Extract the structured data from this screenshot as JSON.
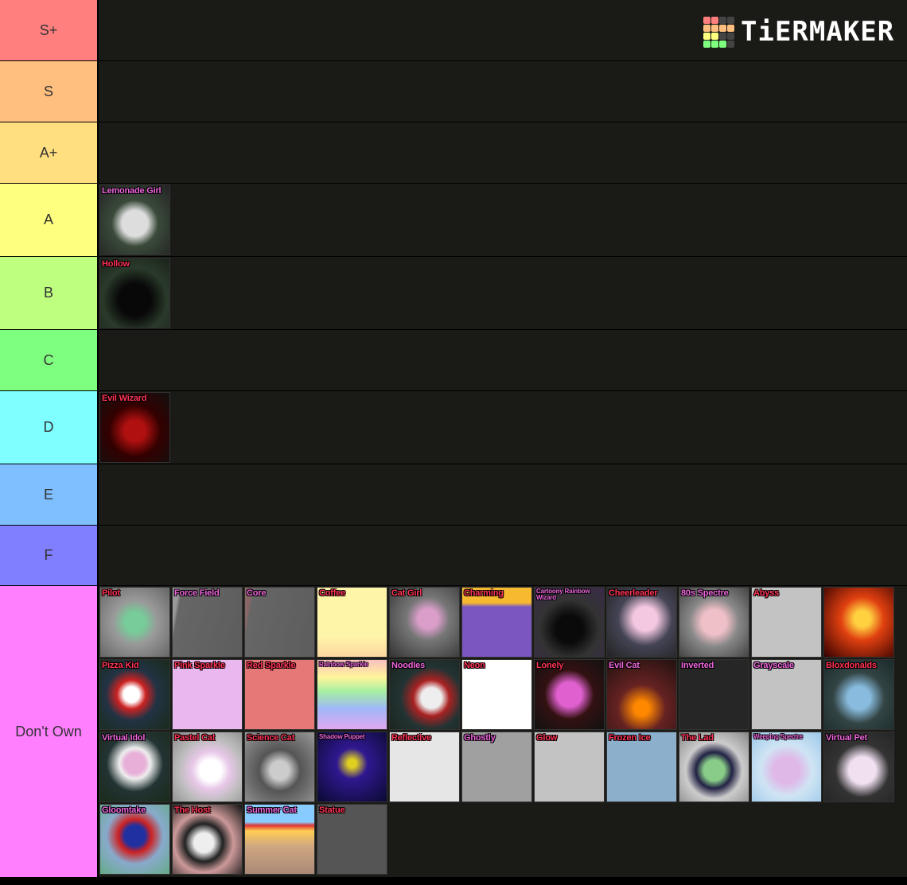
{
  "brand": {
    "logo_text": "TiERMAKER",
    "grid_colors": [
      "#ff7f7f",
      "#ff7f7f",
      "#444",
      "#444",
      "#ffbf7f",
      "#ffbf7f",
      "#ffbf7f",
      "#ffbf7f",
      "#ffff7f",
      "#ffff7f",
      "#444",
      "#444",
      "#7fff7f",
      "#7fff7f",
      "#7fff7f",
      "#444"
    ]
  },
  "tiers": [
    {
      "label": "S+",
      "color": "#ff7f7f",
      "items": []
    },
    {
      "label": "S",
      "color": "#ffbf7f",
      "items": []
    },
    {
      "label": "A+",
      "color": "#ffdf7f",
      "items": []
    },
    {
      "label": "A",
      "color": "#ffff7f",
      "items": [
        {
          "name": "Lemonade Girl",
          "c": "pink",
          "bg": "radial-gradient(circle at 50% 55%,#ddd 0 25%,#3a4a3a 45%,#222)"
        }
      ]
    },
    {
      "label": "B",
      "color": "#bfff7f",
      "items": [
        {
          "name": "Hollow",
          "c": "red",
          "bg": "radial-gradient(circle at 50% 60%,#080808 0 30%,#2a3a2a 60%,#1a221a)"
        }
      ]
    },
    {
      "label": "C",
      "color": "#7fff7f",
      "items": []
    },
    {
      "label": "D",
      "color": "#7fffff",
      "items": [
        {
          "name": "Evil Wizard",
          "c": "red",
          "bg": "radial-gradient(circle at 50% 55%,#b01010 0 20%,#300 50%,#111)"
        }
      ]
    },
    {
      "label": "E",
      "color": "#7fbfff",
      "items": []
    },
    {
      "label": "F",
      "color": "#7f7fff",
      "items": []
    },
    {
      "label": "Don't Own",
      "color": "#ff7fff",
      "items": [
        {
          "name": "Pilot",
          "c": "red",
          "bg": "radial-gradient(circle at 50% 50%,#7c9 0 20%,#999 45%,#666)"
        },
        {
          "name": "Force Field",
          "c": "pink",
          "bg": "linear-gradient(100deg,#999 0 8%,#666 12%,#5d5d5d)"
        },
        {
          "name": "Core",
          "c": "pink",
          "bg": "linear-gradient(100deg,#866 0 8%,#666 12%,#5d5d5d)"
        },
        {
          "name": "Coffee",
          "c": "red",
          "bg": "linear-gradient(#fff5a8 70%,#fcd7a0)"
        },
        {
          "name": "Cat Girl",
          "c": "red",
          "bg": "radial-gradient(circle at 55% 45%,#db9ecb 0 18%,#777 40%,#333)"
        },
        {
          "name": "Charming",
          "c": "red",
          "bg": "linear-gradient(#f7b930 0 22%,#7b55c0 28%)"
        },
        {
          "name": "Cartoony Rainbow Wizard",
          "c": "pink",
          "small": true,
          "bg": "radial-gradient(circle at 50% 60%,#0a0a0a 0 25%,#333 55%,#3a2a4a)"
        },
        {
          "name": "Cheerleader",
          "c": "red",
          "bg": "radial-gradient(circle at 55% 45%,#f4c8e0 0 22%,#445 50%,#222)"
        },
        {
          "name": "80s Spectre",
          "c": "pink",
          "bg": "radial-gradient(circle at 50% 50%,#f0c0c8 0 25%,#888 50%,#444)"
        },
        {
          "name": "Abyss",
          "c": "red",
          "bg": "#c3c3c3"
        },
        {
          "name": "",
          "c": "red",
          "bg": "radial-gradient(circle at 55% 45%,#ffd040 0 15%,#e04010 40%,#300)"
        },
        {
          "name": "Pizza Kid",
          "c": "red",
          "bg": "radial-gradient(circle at 45% 50%,#fff 0 15%,#c22 28%,#234 50%,#1a2a1a)"
        },
        {
          "name": "Pink Sparkle",
          "c": "red",
          "bg": "#eab8ee"
        },
        {
          "name": "Red Sparkle",
          "c": "red",
          "bg": "#e77878"
        },
        {
          "name": "Rainbow Sparkle",
          "c": "pink",
          "small": true,
          "bg": "linear-gradient(#f9c0c0,#fff59a 25%,#a8f0a0 45%,#a0b8f8 70%,#e0a8f0)"
        },
        {
          "name": "Noodles",
          "c": "pink",
          "bg": "radial-gradient(circle at 60% 55%,#eee 0 18%,#a22 32%,#233 55%,#1a221a)"
        },
        {
          "name": "Neon",
          "c": "red",
          "bg": "#ffffff"
        },
        {
          "name": "Lonely",
          "c": "red",
          "bg": "radial-gradient(circle at 50% 50%,#e060d0 0 25%,#311 50%,#111)"
        },
        {
          "name": "Evil Cat",
          "c": "pink",
          "bg": "radial-gradient(circle at 50% 70%,#f80 0 12%,#622 40%,#211)"
        },
        {
          "name": "Inverted",
          "c": "pink",
          "bg": "#262626"
        },
        {
          "name": "Grayscale",
          "c": "pink",
          "bg": "#c3c3c3"
        },
        {
          "name": "Bloxdonalds",
          "c": "red",
          "bg": "radial-gradient(circle at 50% 55%,#8bd 0 22%,#344 50%,#1a2a2a)"
        },
        {
          "name": "Virtual Idol",
          "c": "pink",
          "bg": "radial-gradient(circle at 50% 45%,#e8b0d8 0 20%,#eee 30%,#233 55%,#1a2a1a)"
        },
        {
          "name": "Pastel Cat",
          "c": "red",
          "bg": "radial-gradient(circle at 55% 55%,#fff 0 20%,#e8c8e8 35%,#bbb 60%,#888)"
        },
        {
          "name": "Science Cat",
          "c": "red",
          "bg": "radial-gradient(circle at 50% 55%,#ccc 0 18%,#555 40%,#999)"
        },
        {
          "name": "Shadow Puppet",
          "c": "pink",
          "small": true,
          "bg": "radial-gradient(circle at 50% 45%,#e0d020 0 8%,#301890 30%,#0a0a30)"
        },
        {
          "name": "Reflective",
          "c": "red",
          "bg": "#e6e6e6"
        },
        {
          "name": "Ghostly",
          "c": "pink",
          "bg": "#a0a0a0"
        },
        {
          "name": "Glow",
          "c": "red",
          "bg": "#c3c3c3"
        },
        {
          "name": "Frozen Ice",
          "c": "red",
          "bg": "#8cb0cc"
        },
        {
          "name": "The Lad",
          "c": "red",
          "bg": "radial-gradient(circle at 50% 55%,#8c8 0 20%,#224 35%,#ccc 55%,#888)"
        },
        {
          "name": "Weeping Spectre",
          "c": "pink",
          "small": true,
          "bg": "radial-gradient(circle at 50% 55%,#e0b8e8 0 25%,#cfe4f4 50%,#9cc8e8)"
        },
        {
          "name": "Virtual Pet",
          "c": "pink",
          "bg": "radial-gradient(circle at 55% 55%,#f0e0f0 0 25%,#333 50%,#222)"
        },
        {
          "name": "Gloomtake",
          "c": "pink",
          "bg": "radial-gradient(circle at 50% 45%,#2030a0 0 20%,#c22 32%,#8ac 55%,#6a8)"
        },
        {
          "name": "The Host",
          "c": "red",
          "bg": "radial-gradient(circle at 45% 55%,#eee 0 18%,#222 35%,#c99 55%,#111)"
        },
        {
          "name": "Summer Cat",
          "c": "pink",
          "bg": "linear-gradient(#8cf 0 25%,#d33 30%,#fc5 38%,#cfa880 60%,#a87)"
        },
        {
          "name": "Statue",
          "c": "red",
          "bg": "#555"
        }
      ]
    }
  ]
}
